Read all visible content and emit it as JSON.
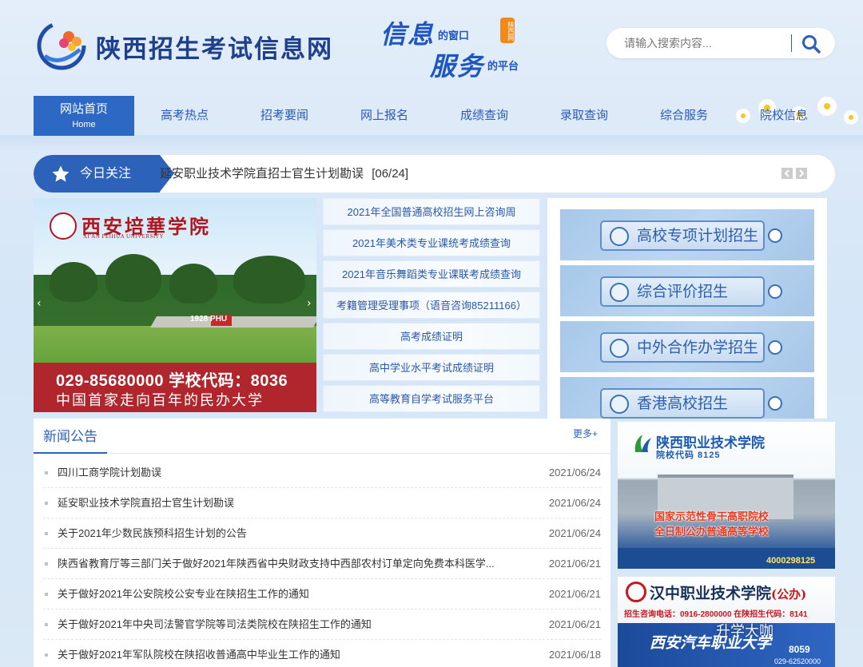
{
  "header": {
    "site_name": "陕西招生考试信息网",
    "slogan": {
      "line1_big": "信息",
      "line1_small": "的窗口",
      "line2_big": "服务",
      "line2_small": "的平台",
      "stamp": "陕西网"
    },
    "search": {
      "placeholder": "请输入搜索内容..."
    }
  },
  "nav": {
    "items": [
      {
        "label": "网站首页",
        "sub": "Home",
        "active": true
      },
      {
        "label": "高考热点"
      },
      {
        "label": "招考要闻"
      },
      {
        "label": "网上报名"
      },
      {
        "label": "成绩查询"
      },
      {
        "label": "录取查询"
      },
      {
        "label": "综合服务"
      },
      {
        "label": "院校信息"
      }
    ]
  },
  "today": {
    "label": "今日关注",
    "headline": "延安职业技术学院直招士官生计划勘误",
    "date": "[06/24]"
  },
  "banner": {
    "school_name": "西安培華学院",
    "school_name_en": "XI'AN PEIHUA UNIVERSITY",
    "sign": "1928 PHU",
    "phone_line": "029-85680000   学校代码：8036",
    "motto": "中国首家走向百年的民办大学"
  },
  "quick_links": [
    "2021年全国普通高校招生网上咨询周",
    "2021年美术类专业课统考成绩查询",
    "2021年音乐舞蹈类专业课联考成绩查询",
    "考籍管理受理事项（语音咨询85211166）",
    "高考成绩证明",
    "高中学业水平考试成绩证明",
    "高等教育自学考试服务平台"
  ],
  "special_recruit": [
    "高校专项计划招生",
    "综合评价招生",
    "中外合作办学招生",
    "香港高校招生"
  ],
  "news": {
    "title": "新闻公告",
    "more": "更多+",
    "items": [
      {
        "title": "四川工商学院计划勘误",
        "date": "2021/06/24"
      },
      {
        "title": "延安职业技术学院直招士官生计划勘误",
        "date": "2021/06/24"
      },
      {
        "title": "关于2021年少数民族预科招生计划的公告",
        "date": "2021/06/24"
      },
      {
        "title": "陕西省教育厅等三部门关于做好2021年陕西省中央财政支持中西部农村订单定向免费本科医学...",
        "date": "2021/06/21"
      },
      {
        "title": "关于做好2021年公安院校公安专业在陕招生工作的通知",
        "date": "2021/06/21"
      },
      {
        "title": "关于做好2021年中央司法警官学院等司法类院校在陕招生工作的通知",
        "date": "2021/06/21"
      },
      {
        "title": "关于做好2021年军队院校在陕招收普通高中毕业生工作的通知",
        "date": "2021/06/18"
      }
    ]
  },
  "ads": {
    "ad1": {
      "name": "陕西职业技术学院",
      "code": "院校代码 8125",
      "line1": "国家示范性骨干高职院校",
      "line2": "全日制公办普通高等学校",
      "phone": "4000298125"
    },
    "ad2": {
      "name": "汉中职业技术学院",
      "tag": "(公办)",
      "hotline": "招生咨询电话：0916-2800000 在陕招生代码：8141",
      "name2": "西安汽车职业大学",
      "code": "8059",
      "tel": "029-62520000"
    }
  },
  "watermark": "升学大咖",
  "colors": {
    "primary": "#2d62bb",
    "nav_active": "#2d69c4",
    "link": "#2a58a8",
    "banner_red": "#b0262c"
  }
}
